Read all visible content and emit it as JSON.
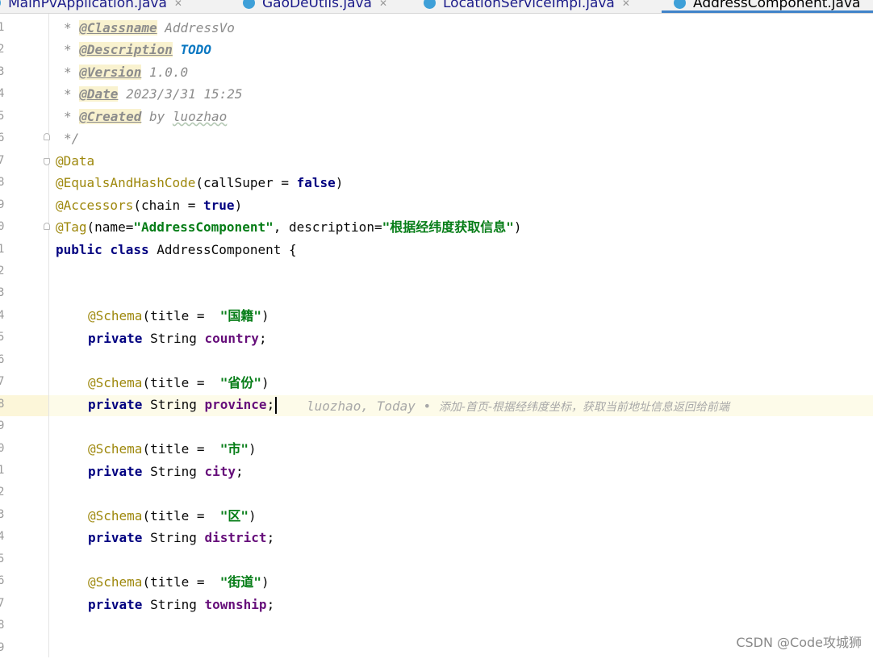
{
  "tabs": [
    {
      "label": "MainPvApplication.java",
      "active": false
    },
    {
      "label": "GaoDeUtils.java",
      "active": false
    },
    {
      "label": "LocationServiceImpl.java",
      "active": false
    },
    {
      "label": "AddressComponent.java",
      "active": true
    }
  ],
  "colors": {
    "annotation": "#9e880d",
    "keyword": "#000080",
    "string": "#067d17",
    "field": "#660e7a",
    "doc": "#8c8c8c",
    "todo": "#0b78c2",
    "tab_underline": "#4083c9"
  },
  "line_numbers": [
    "1",
    "2",
    "3",
    "4",
    "5",
    "6",
    "7",
    "8",
    "9",
    "0",
    "1",
    "2",
    "3",
    "4",
    "5",
    "6",
    "7",
    "8",
    "9",
    "0",
    "1",
    "2",
    "3",
    "4",
    "5",
    "6",
    "7",
    "8",
    "9"
  ],
  "code": {
    "doc_prefix": "* ",
    "classname_tag": "@Classname",
    "classname_val": " AddressVo",
    "description_tag": "@Description",
    "description_val": "TODO",
    "version_tag": "@Version",
    "version_val": " 1.0.0",
    "date_tag": "@Date",
    "date_val": " 2023/3/31 15:25",
    "created_tag": "@Created",
    "created_by": " by ",
    "created_name": "luozhao",
    "doc_end": "*/",
    "ann_data": "@Data",
    "ann_equals": "@EqualsAndHashCode",
    "equals_args_open": "(callSuper = ",
    "kw_false": "false",
    "paren_close": ")",
    "ann_accessors": "@Accessors",
    "accessors_open": "(chain = ",
    "kw_true": "true",
    "ann_tag": "@Tag",
    "tag_open": "(name=",
    "tag_name": "\"AddressComponent\"",
    "tag_mid": ", description=",
    "tag_desc": "\"根据经纬度获取信息\"",
    "kw_public": "public",
    "kw_class": "class",
    "class_name": " AddressComponent {",
    "ann_schema": "@Schema",
    "schema_open": "(title =  ",
    "kw_private": "private",
    "type_string": " String ",
    "semi": ";",
    "fields": [
      {
        "title": "\"国籍\"",
        "name": "country"
      },
      {
        "title": "\"省份\"",
        "name": "province"
      },
      {
        "title": "\"市\"",
        "name": "city"
      },
      {
        "title": "\"区\"",
        "name": "district"
      },
      {
        "title": "\"街道\"",
        "name": "township"
      }
    ]
  },
  "blame": {
    "author": "luozhao, Today • ",
    "message": "添加-首页-根据经纬度坐标，获取当前地址信息返回给前端"
  },
  "watermark": "CSDN @Code攻城狮"
}
